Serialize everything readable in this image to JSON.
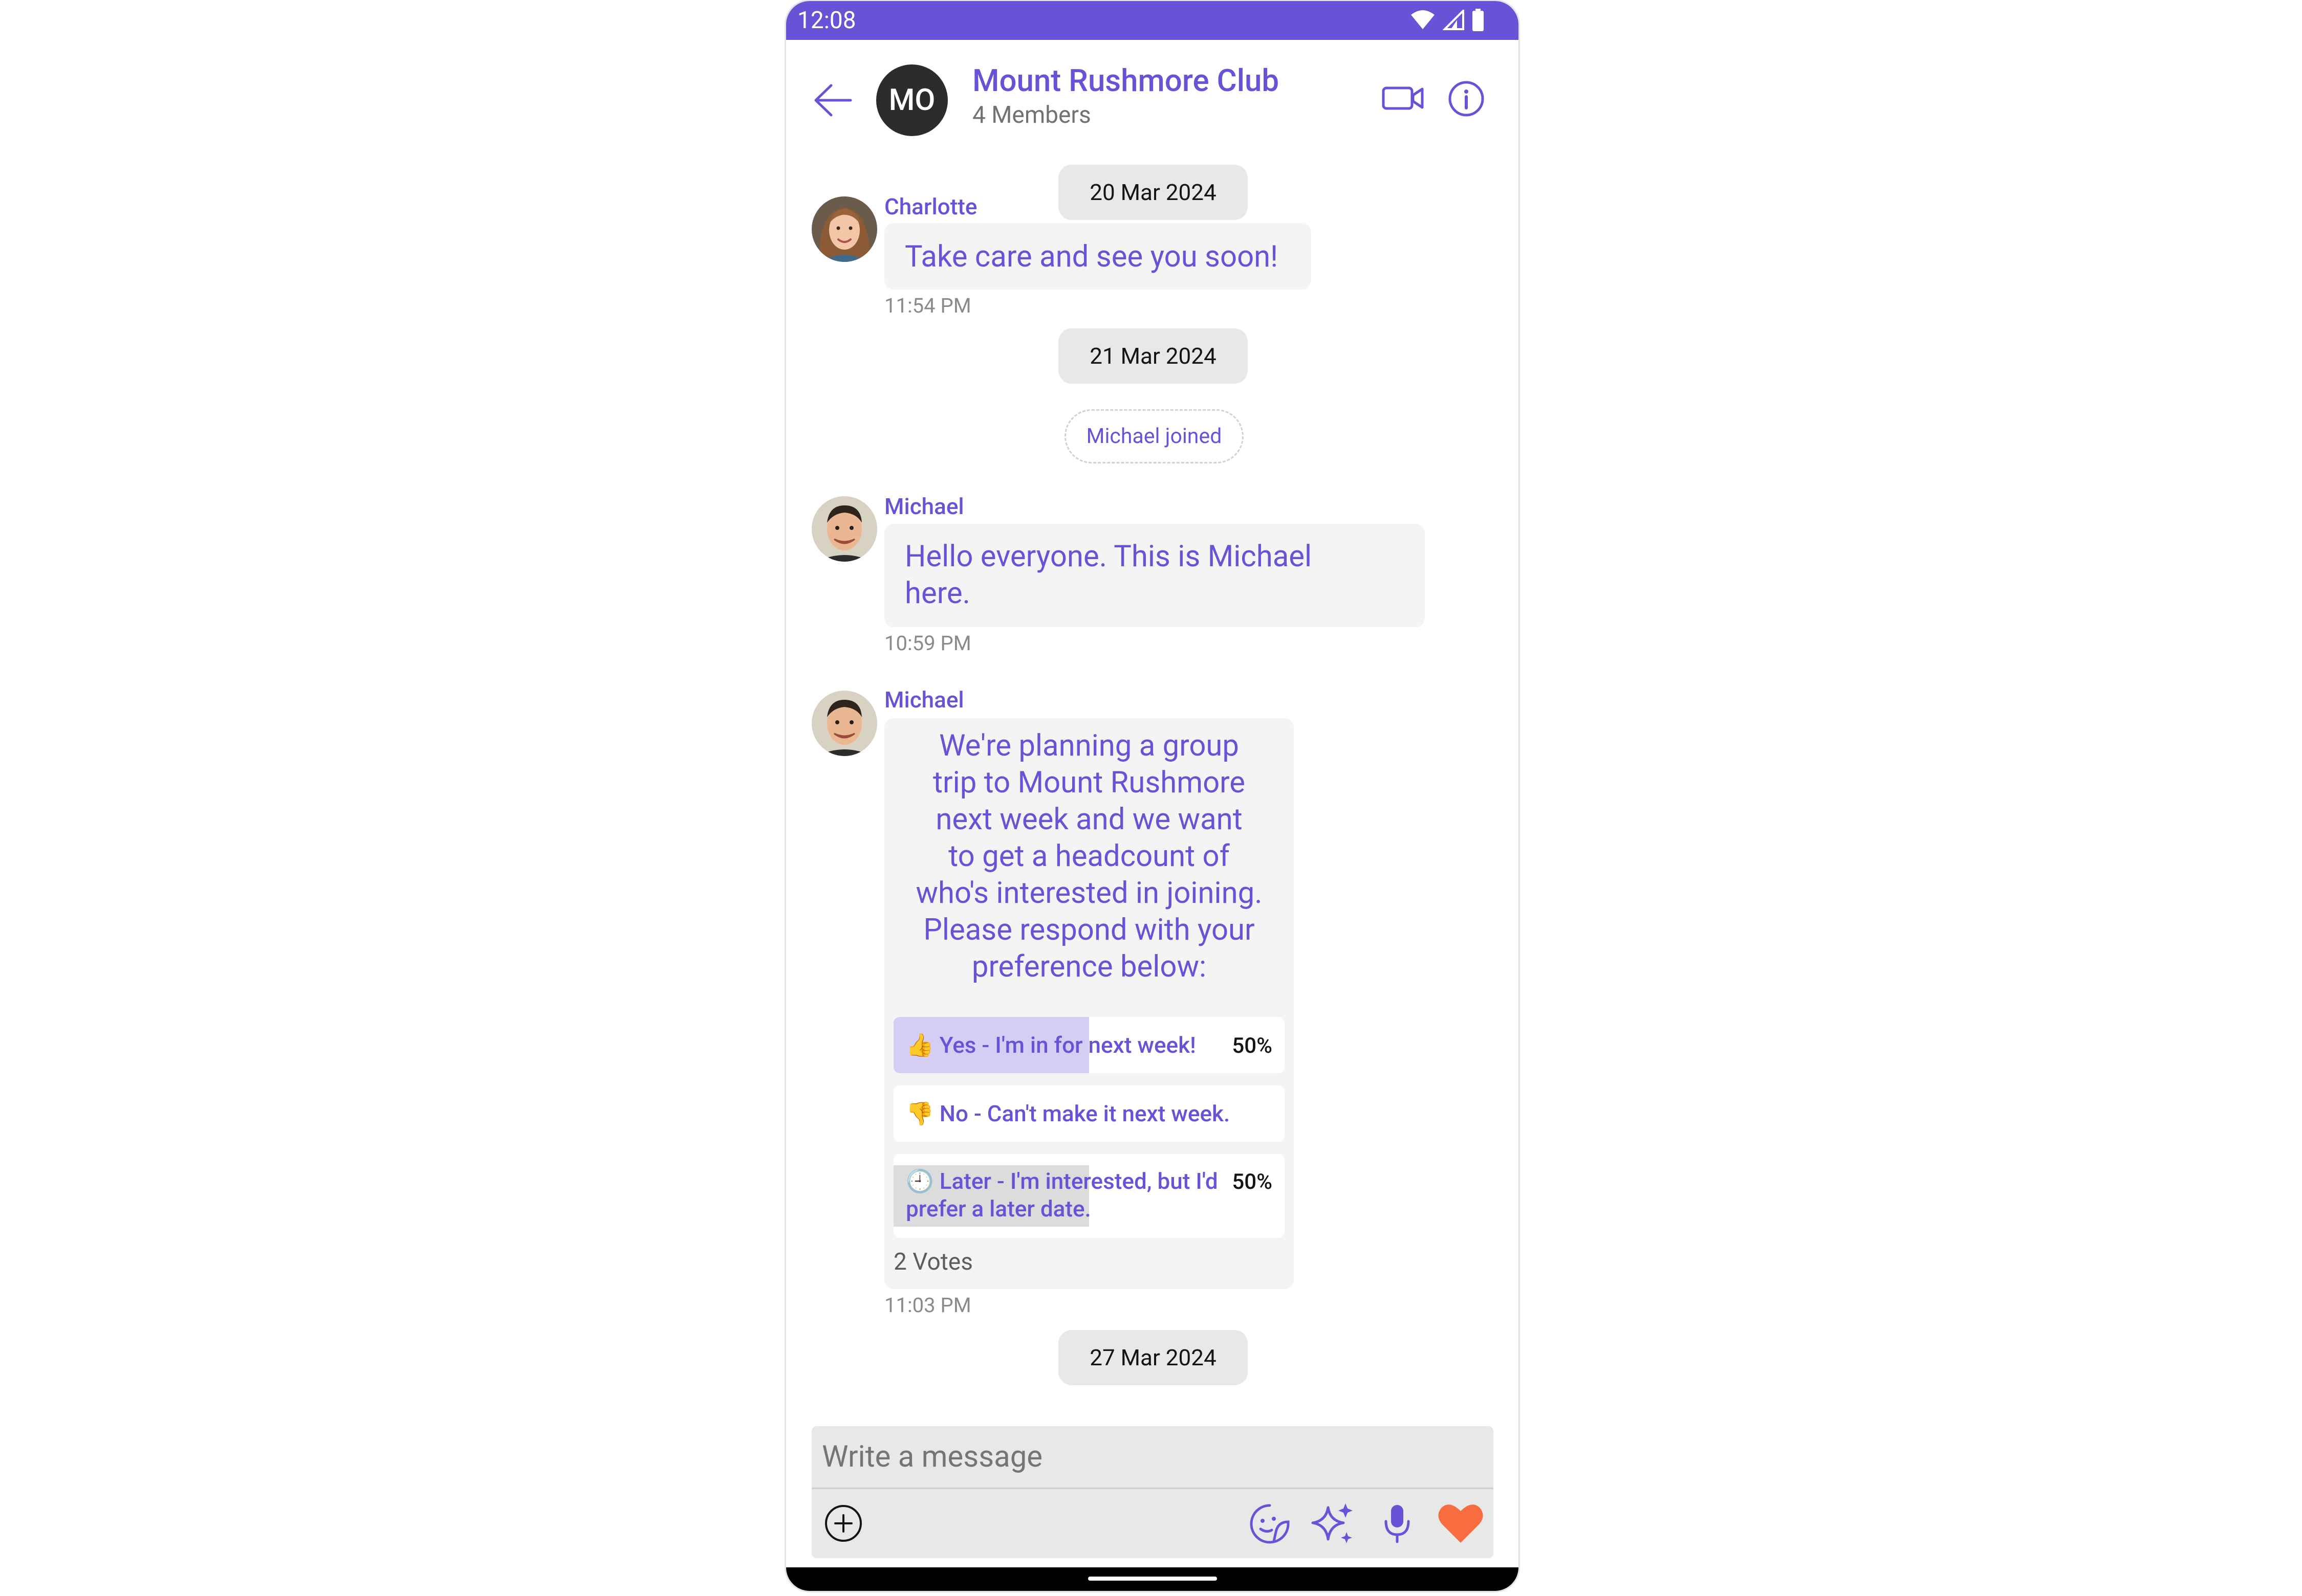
{
  "status_bar": {
    "time": "12:08"
  },
  "header": {
    "avatar_initials": "MO",
    "group_name": "Mount Rushmore Club",
    "members": "4 Members"
  },
  "messages": {
    "date1": "20 Mar 2024",
    "charlotte": {
      "sender": "Charlotte",
      "text": "Take care and see you soon!",
      "time": "11:54 PM"
    },
    "date2": "21 Mar 2024",
    "action": "Michael joined",
    "michael1": {
      "sender": "Michael",
      "text_line1": "Hello everyone. This is Michael",
      "text_line2": "here.",
      "time": "10:59 PM"
    },
    "michael2": {
      "sender": "Michael",
      "question_lines": [
        "We're planning a group",
        "trip to Mount Rushmore",
        "next week and we want",
        "to get a headcount of",
        "who's interested in joining.",
        "Please respond with your",
        "preference below:"
      ],
      "options": [
        {
          "emoji": "👍",
          "label": "Yes - I'm in for next week!",
          "percent": "50%",
          "fraction": 0.5
        },
        {
          "emoji": "👎",
          "label": "No - Can't make it next week.",
          "percent": "",
          "fraction": 0
        },
        {
          "emoji": "🕘",
          "label_line1": "Later - I'm interested, but I'd",
          "label_line2": "prefer a later date.",
          "percent": "50%",
          "fraction": 0.5
        }
      ],
      "votes": "2 Votes",
      "time": "11:03 PM"
    },
    "date3": "27 Mar 2024"
  },
  "composer": {
    "placeholder": "Write a message"
  },
  "colors": {
    "primary": "#6852d6",
    "heart": "#f76d3f",
    "poll_fill_selected": "#d4cdf4",
    "poll_fill_other": "#dcdcdc"
  }
}
